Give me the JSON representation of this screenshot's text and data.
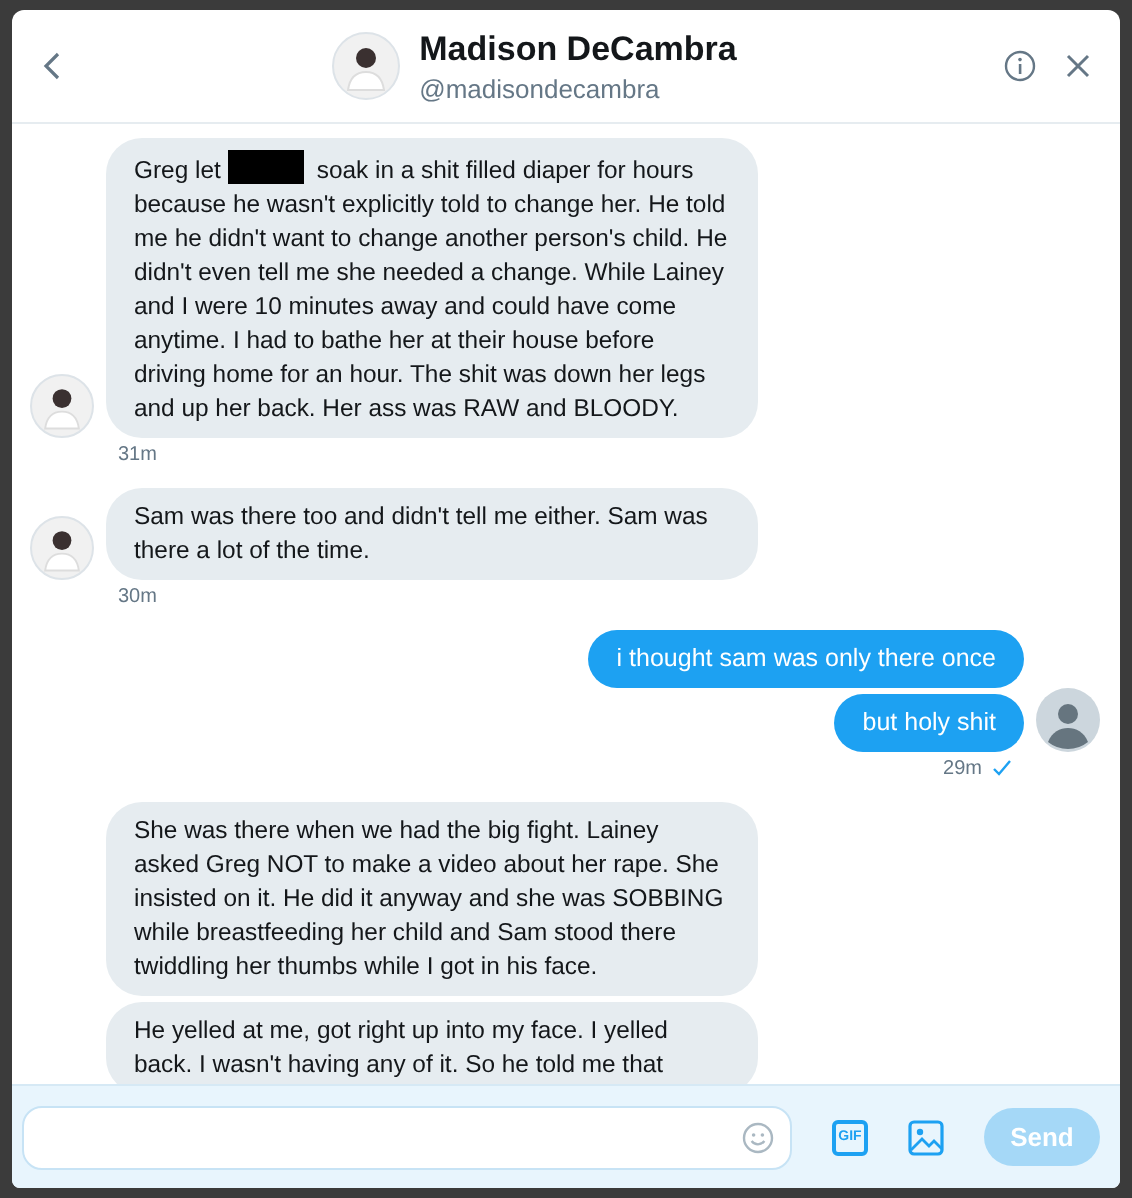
{
  "header": {
    "name": "Madison DeCambra",
    "handle": "@madisondecambra"
  },
  "messages": [
    {
      "kind": "received",
      "show_avatar": true,
      "parts": [
        {
          "kind": "text",
          "text": "Greg let"
        },
        {
          "kind": "redacted"
        },
        {
          "kind": "text",
          "text": "soak in a shit filled diaper for hours"
        },
        {
          "kind": "block",
          "text": "because he wasn't explicitly told to change her. He told me he didn't want to change another person's child. He didn't even tell me she needed a change. While Lainey and I were 10 minutes away and could have come anytime. I had to bathe her at their house before driving home for an hour. The shit was down her legs and up her back. Her ass was RAW and BLOODY."
        }
      ],
      "time": "31m"
    },
    {
      "kind": "received",
      "show_avatar": true,
      "parts": [
        {
          "kind": "block",
          "text": "Sam was there too and didn't tell me either. Sam was there a lot of the time."
        }
      ],
      "time": "30m"
    },
    {
      "kind": "sent",
      "show_avatar": false,
      "parts": [
        {
          "kind": "block",
          "text": "i thought sam was only there once"
        }
      ]
    },
    {
      "kind": "sent",
      "show_avatar": true,
      "parts": [
        {
          "kind": "block",
          "text": "but holy shit"
        }
      ],
      "time": "29m",
      "read": true
    },
    {
      "kind": "received",
      "show_avatar": false,
      "parts": [
        {
          "kind": "block",
          "text": "She was there when we had the big fight. Lainey asked Greg NOT to make a video about her rape. She insisted on it. He did it anyway and she was SOBBING while breastfeeding her child and Sam stood there twiddling her thumbs while I got in his face."
        }
      ]
    },
    {
      "kind": "received",
      "show_avatar": false,
      "parts": [
        {
          "kind": "block",
          "text": "He yelled at me, got right up into my face. I yelled back. I wasn't having any of it. So he told me that"
        }
      ]
    }
  ],
  "composer": {
    "gif_label": "GIF",
    "send_label": "Send",
    "send_disabled": true
  }
}
